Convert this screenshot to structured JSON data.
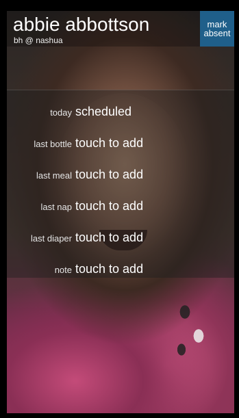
{
  "header": {
    "child_name": "abbie abbottson",
    "location": "bh @ nashua",
    "mark_absent": [
      "mark",
      "absent"
    ]
  },
  "rows": [
    {
      "label": "today",
      "value": "scheduled"
    },
    {
      "label": "last bottle",
      "value": "touch to add"
    },
    {
      "label": "last meal",
      "value": "touch to add"
    },
    {
      "label": "last nap",
      "value": "touch to add"
    },
    {
      "label": "last diaper",
      "value": "touch to add"
    },
    {
      "label": "note",
      "value": "touch to add"
    }
  ],
  "colors": {
    "accent": "#1f5f8a"
  }
}
